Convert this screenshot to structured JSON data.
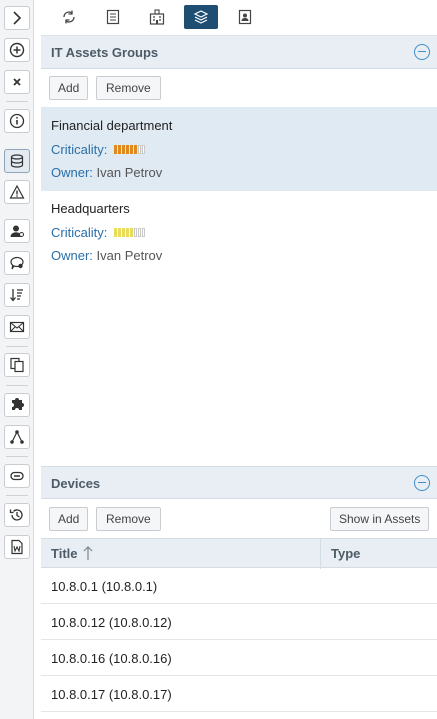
{
  "rail": {
    "icons": [
      "chevron-right-icon",
      "add-circle-icon",
      "close-icon",
      "info-icon",
      "database-icon",
      "warning-icon",
      "user-icon",
      "chat-search-icon",
      "sort-icon",
      "mail-icon",
      "copy-icon",
      "puzzle-icon",
      "topology-icon",
      "link-icon",
      "history-icon",
      "word-doc-icon"
    ]
  },
  "tabs": [
    "refresh-icon",
    "document-icon",
    "building-icon",
    "layers-icon",
    "contact-icon"
  ],
  "groups_section": {
    "title": "IT Assets Groups",
    "add_label": "Add",
    "remove_label": "Remove",
    "items": [
      {
        "name": "Financial department",
        "criticality_label": "Criticality:",
        "criticality_level": 6,
        "criticality_max": 8,
        "owner_label": "Owner:",
        "owner": "Ivan Petrov"
      },
      {
        "name": "Headquarters",
        "criticality_label": "Criticality:",
        "criticality_level": 5,
        "criticality_max": 8,
        "owner_label": "Owner:",
        "owner": "Ivan Petrov"
      }
    ]
  },
  "devices_section": {
    "title": "Devices",
    "add_label": "Add",
    "remove_label": "Remove",
    "show_label": "Show in Assets",
    "col_title": "Title",
    "col_type": "Type",
    "rows": [
      "10.8.0.1 (10.8.0.1)",
      "10.8.0.12 (10.8.0.12)",
      "10.8.0.16 (10.8.0.16)",
      "10.8.0.17 (10.8.0.17)"
    ]
  },
  "colors": {
    "accent": "#1e4f73",
    "crit_high": "#e08a1e",
    "crit_mid": "#e8dc5a",
    "link": "#2a6fa8"
  }
}
